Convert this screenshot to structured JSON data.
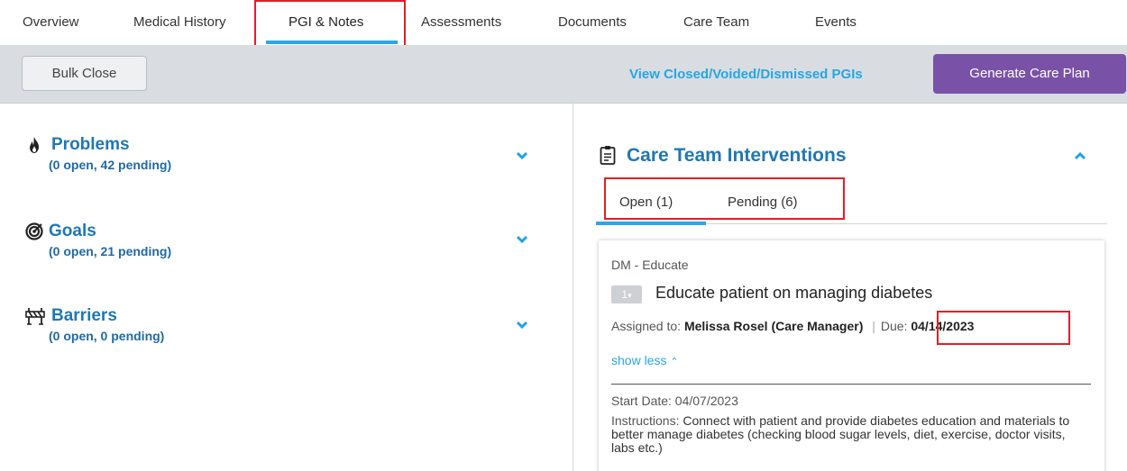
{
  "tabs": [
    {
      "label": "Overview"
    },
    {
      "label": "Medical History"
    },
    {
      "label": "PGI & Notes"
    },
    {
      "label": "Assessments"
    },
    {
      "label": "Documents"
    },
    {
      "label": "Care Team"
    },
    {
      "label": "Events"
    }
  ],
  "active_tab": "PGI & Notes",
  "toolbar": {
    "bulk_close_label": "Bulk Close",
    "view_closed_link": "View Closed/Voided/Dismissed PGIs",
    "generate_care_plan_label": "Generate Care Plan"
  },
  "sections": [
    {
      "title": "Problems",
      "summary": "(0 open, 42 pending)",
      "icon": "fire-icon"
    },
    {
      "title": "Goals",
      "summary": "(0 open, 21 pending)",
      "icon": "target-icon"
    },
    {
      "title": "Barriers",
      "summary": "(0 open, 0 pending)",
      "icon": "barrier-icon"
    }
  ],
  "interventions": {
    "title": "Care Team Interventions",
    "icon": "clipboard-icon",
    "subtabs": [
      {
        "label": "Open (1)"
      },
      {
        "label": "Pending (6)"
      }
    ],
    "card": {
      "category": "DM - Educate",
      "badge": "1",
      "title": "Educate patient on managing diabetes",
      "assigned_label": "Assigned to:",
      "assigned_value": "Melissa Rosel (Care Manager)",
      "separator": "|",
      "due_label": "Due:",
      "due_value": "04/14/2023",
      "show_less": "show less",
      "start_date": "Start Date: 04/07/2023",
      "instructions_label": "Instructions:",
      "instructions_value": "Connect with patient and provide diabetes education and materials to better manage diabetes (checking blood sugar levels, diet, exercise, doctor visits, labs etc.)"
    }
  },
  "colors": {
    "accent": "#2aa7e8",
    "link": "#26a6e4",
    "heading": "#1f78b4",
    "primary_button": "#7952a8",
    "highlight": "#e41e26"
  }
}
